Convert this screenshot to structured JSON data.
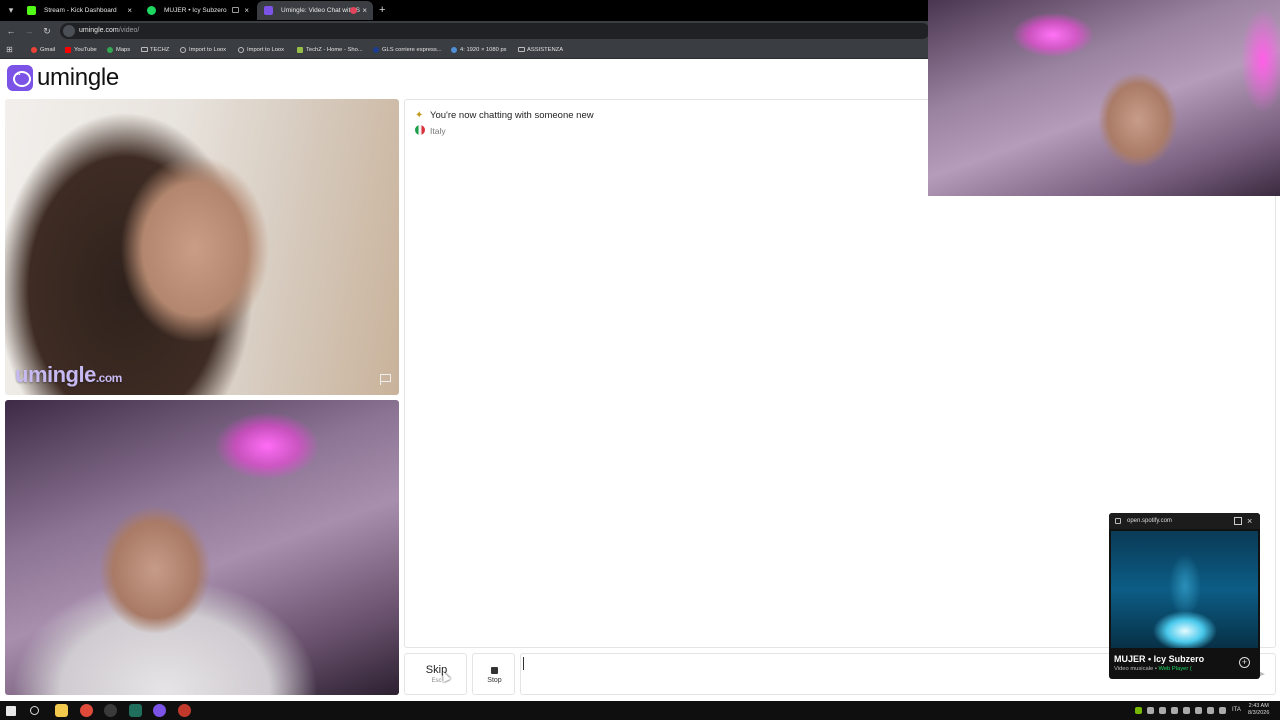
{
  "browser": {
    "tabs": [
      {
        "title": "Stream - Kick Dashboard",
        "active": false,
        "favicon_color": "#53fc18"
      },
      {
        "title": "MUJER • Icy Subzero",
        "active": false,
        "favicon_color": "#1ed760"
      },
      {
        "title": "Umingle: Video Chat with S",
        "active": true,
        "favicon_color": "#7b53e6"
      }
    ],
    "new_tab_symbol": "+",
    "url_host": "umingle.com",
    "url_path": "/video/",
    "bookmarks": [
      {
        "label": "Gmail",
        "icon": "gmail-icon",
        "color": "#ea4335"
      },
      {
        "label": "YouTube",
        "icon": "youtube-icon",
        "color": "#ff0000"
      },
      {
        "label": "Maps",
        "icon": "maps-icon",
        "color": "#34a853"
      },
      {
        "label": "TECHZ",
        "icon": "folder-icon",
        "color": "#bbbbbb"
      },
      {
        "label": "Import to Loox",
        "icon": "globe-icon",
        "color": "#bbbbbb"
      },
      {
        "label": "Import to Loox",
        "icon": "globe-icon",
        "color": "#bbbbbb"
      },
      {
        "label": "TechZ - Home - Sho...",
        "icon": "shopify-icon",
        "color": "#95bf47"
      },
      {
        "label": "GLS corriere espress...",
        "icon": "gls-icon",
        "color": "#1a3d8f"
      },
      {
        "label": "4: 1920 × 1080 px",
        "icon": "resolution-icon",
        "color": "#4f8fd8"
      },
      {
        "label": "ASSISTENZA",
        "icon": "folder-icon",
        "color": "#bbbbbb"
      }
    ]
  },
  "site": {
    "logo_text": "umingle",
    "brand_color": "#7b53e6"
  },
  "stranger_video": {
    "watermark": "umingle",
    "watermark_suffix": ".com"
  },
  "chat": {
    "system_message": "You're now chatting with someone new",
    "country": "Italy"
  },
  "controls": {
    "skip_label": "Skip",
    "skip_hint": "Esc",
    "stop_label": "Stop",
    "message_value": ""
  },
  "mini_player": {
    "site": "open.spotify.com",
    "close_symbol": "×",
    "track_title": "MUJER • Icy Subzero",
    "subtitle": "Video musicale • ",
    "source": "Web Player (",
    "add_symbol": "+"
  },
  "taskbar": {
    "language": "ITA",
    "time": "2:43 AM",
    "date": "8/3/2026"
  }
}
